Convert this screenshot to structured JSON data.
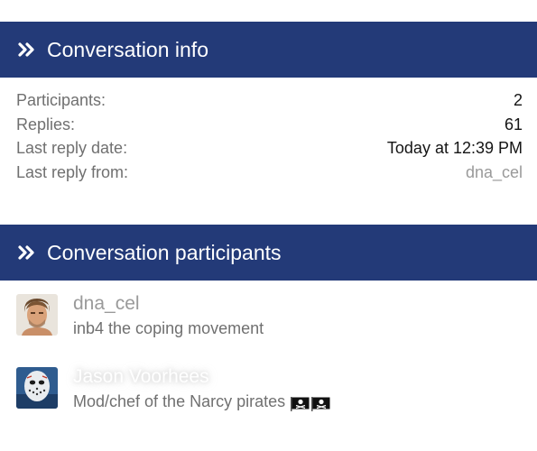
{
  "info_section": {
    "title": "Conversation info",
    "rows": [
      {
        "label": "Participants:",
        "value": "2"
      },
      {
        "label": "Replies:",
        "value": "61"
      },
      {
        "label": "Last reply date:",
        "value": "Today at 12:39 PM"
      },
      {
        "label": "Last reply from:",
        "value": "dna_cel"
      }
    ]
  },
  "participants_section": {
    "title": "Conversation participants",
    "participants": [
      {
        "name": "dna_cel",
        "title": "inb4 the coping movement",
        "avatar": "portrait-avatar"
      },
      {
        "name": "Jason Voorhees",
        "title": "Mod/chef of the Narcy pirates",
        "avatar": "hockey-mask-avatar",
        "badges": [
          "pirate-flag-icon",
          "pirate-flag-icon"
        ]
      }
    ]
  },
  "colors": {
    "header_bg": "#233a78",
    "header_text": "#ffffff",
    "label_text": "#707070",
    "link_text": "#9a9a9a"
  }
}
